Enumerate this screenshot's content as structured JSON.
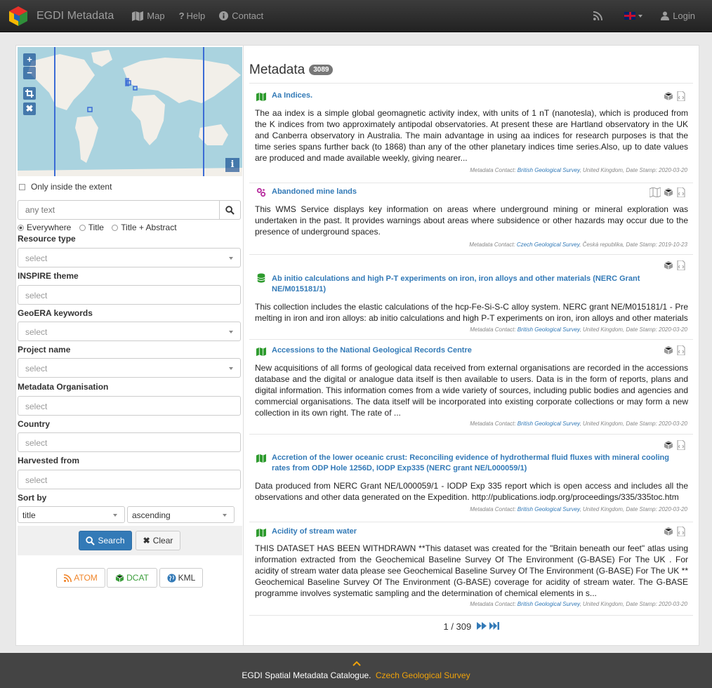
{
  "nav": {
    "brand": "EGDI Metadata",
    "map": "Map",
    "help": "Help",
    "contact": "Contact",
    "login": "Login"
  },
  "search": {
    "only_inside": "Only inside the extent",
    "placeholder": "any text",
    "scope_everywhere": "Everywhere",
    "scope_title": "Title",
    "scope_title_abstract": "Title + Abstract"
  },
  "filters": [
    {
      "label": "Resource type",
      "value": "select"
    },
    {
      "label": "INSPIRE theme",
      "value": "select"
    },
    {
      "label": "GeoERA keywords",
      "value": "select"
    },
    {
      "label": "Project name",
      "value": "select"
    },
    {
      "label": "Metadata Organisation",
      "value": "select"
    },
    {
      "label": "Country",
      "value": "select"
    },
    {
      "label": "Harvested from",
      "value": "select"
    }
  ],
  "sort": {
    "label": "Sort by",
    "field": "title",
    "order": "ascending"
  },
  "buttons": {
    "search": "Search",
    "clear": "Clear"
  },
  "exports": {
    "atom": "ATOM",
    "dcat": "DCAT",
    "kml": "KML"
  },
  "colors": {
    "accent": "#337ab7",
    "atom": "#f0852a",
    "dcat": "#3a9d3a",
    "footer_link": "#f0a30a"
  },
  "metadata": {
    "title": "Metadata",
    "count": "3089"
  },
  "records": [
    {
      "title": "Aa Indices.",
      "icon": "map-icon",
      "abstract": "The aa index is a simple global geomagnetic activity index, with units of 1 nT (nanotesla), which is produced from the K indices from two approximately antipodal observatories. At present these are Hartland observatory in the UK and Canberra observatory in Australia. The main advantage in using aa indices for research purposes is that the time series spans further back (to 1868) than any of the other planetary indices time series.Also, up to date values are produced and made available weekly, giving nearer...",
      "meta_prefix": "Metadata Contact: ",
      "meta_org": "British Geological Survey",
      "meta_suffix": ", United Kingdom, Date Stamp: 2020-03-20"
    },
    {
      "title": "Abandoned mine lands",
      "icon": "service-icon",
      "abstract": "This WMS Service displays key information on areas where underground mining or mineral exploration was undertaken in the past. It provides warnings about areas where subsidence or other hazards may occur due to the presence of underground spaces.",
      "meta_prefix": "Metadata Contact: ",
      "meta_org": "Czech Geological Survey",
      "meta_suffix": ", Česká republika, Date Stamp: 2019-10-23"
    },
    {
      "title": "Ab initio calculations and high P-T experiments on iron, iron alloys and other materials (NERC Grant NE/M015181/1)",
      "icon": "database-icon",
      "abstract": "This collection includes the elastic calculations of the hcp-Fe-Si-S-C alloy system. NERC grant NE/M015181/1 - Pre melting in iron and iron alloys: ab initio calculations and high P-T experiments on iron, iron alloys and other materials",
      "meta_prefix": "Metadata Contact: ",
      "meta_org": "British Geological Survey",
      "meta_suffix": ", United Kingdom, Date Stamp: 2020-03-20"
    },
    {
      "title": "Accessions to the National Geological Records Centre",
      "icon": "map-icon",
      "abstract": "New acquisitions of all forms of geological data received from external organisations are recorded in the accessions database and the digital or analogue data itself is then available to users. Data is in the form of reports, plans and digital information. This information comes from a wide variety of sources, including public bodies and agencies and commercial organisations. The data itself will be incorporated into existing corporate collections or may form a new collection in its own right. The rate of ...",
      "meta_prefix": "Metadata Contact: ",
      "meta_org": "British Geological Survey",
      "meta_suffix": ", United Kingdom, Date Stamp: 2020-03-20"
    },
    {
      "title": "Accretion of the lower oceanic crust: Reconciling evidence of hydrothermal fluid fluxes with mineral cooling rates from ODP Hole 1256D, IODP Exp335 (NERC grant NE/L000059/1)",
      "icon": "map-icon",
      "abstract": "Data produced from NERC Grant NE/L000059/1 - IODP Exp 335 report which is open access and includes all the observations and other data generated on the Expedition. http://publications.iodp.org/proceedings/335/335toc.htm",
      "meta_prefix": "Metadata Contact: ",
      "meta_org": "British Geological Survey",
      "meta_suffix": ", United Kingdom, Date Stamp: 2020-03-20"
    },
    {
      "title": "Acidity of stream water",
      "icon": "map-icon",
      "abstract": "THIS DATASET HAS BEEN WITHDRAWN **This dataset was created for the \"Britain beneath our feet\" atlas using information extracted from the Geochemical Baseline Survey Of The Environment (G-BASE) For The UK . For acidity of stream water data please see Geochemical Baseline Survey Of The Environment (G-BASE) For The UK ** Geochemical Baseline Survey Of The Environment (G-BASE) coverage for acidity of stream water. The G-BASE programme involves systematic sampling and the determination of chemical elements in s...",
      "meta_prefix": "Metadata Contact: ",
      "meta_org": "British Geological Survey",
      "meta_suffix": ", United Kingdom, Date Stamp: 2020-03-20"
    }
  ],
  "pager": {
    "text": "1 / 309"
  },
  "footer": {
    "text": "EGDI Spatial Metadata Catalogue.",
    "link": "Czech Geological Survey"
  }
}
